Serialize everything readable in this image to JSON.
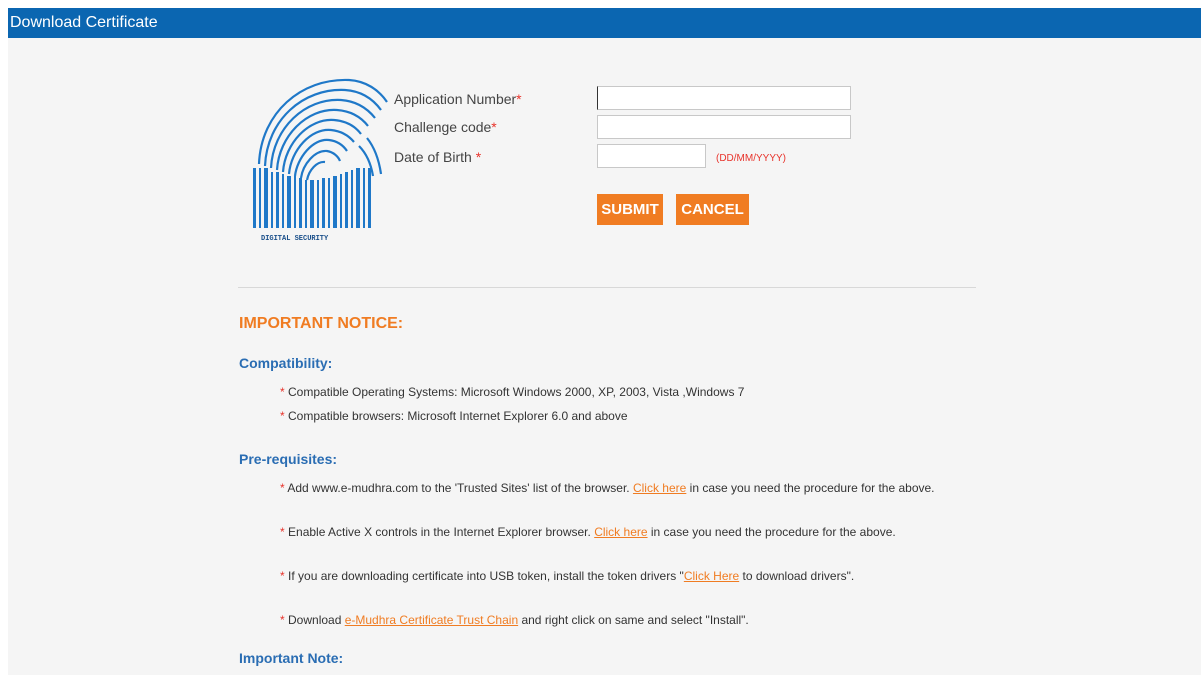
{
  "header": {
    "title": "Download Certificate"
  },
  "logo": {
    "caption": "DIGITAL SECURITY"
  },
  "form": {
    "application_number_label": "Application Number",
    "challenge_code_label": "Challenge code",
    "dob_label": "Date of Birth ",
    "required_marker": "*",
    "application_number_value": "",
    "challenge_code_value": "",
    "dob_value": "",
    "dob_hint": "(DD/MM/YYYY)",
    "submit_label": "SUBMIT",
    "cancel_label": "CANCEL"
  },
  "notice": {
    "title": "IMPORTANT NOTICE:",
    "compatibility_title": "Compatibility:",
    "compatibility_items": [
      "Compatible Operating Systems: Microsoft Windows 2000, XP, 2003, Vista ,Windows 7",
      "Compatible browsers: Microsoft Internet Explorer 6.0 and above"
    ],
    "prereq_title": "Pre-requisites:",
    "prereq": {
      "item1_before": "Add www.e-mudhra.com to the 'Trusted Sites' list of the browser. ",
      "item1_link": "Click here",
      "item1_after": " in case you need the procedure for the above.",
      "item2_before": "Enable Active X controls in the Internet Explorer browser. ",
      "item2_link": "Click here",
      "item2_after": " in case you need the procedure for the above.",
      "item3_before": "If you are downloading certificate into USB token, install the token drivers \"",
      "item3_link": "Click Here",
      "item3_after": " to download drivers\".",
      "item4_before": "Download ",
      "item4_link": "e-Mudhra Certificate Trust Chain",
      "item4_after": " and right click on same and select \"Install\"."
    },
    "note_title": "Important Note:"
  },
  "colors": {
    "header_bg": "#0b66b1",
    "accent_orange": "#f07c22",
    "required_red": "#e8332b",
    "section_blue": "#2a6db3"
  }
}
